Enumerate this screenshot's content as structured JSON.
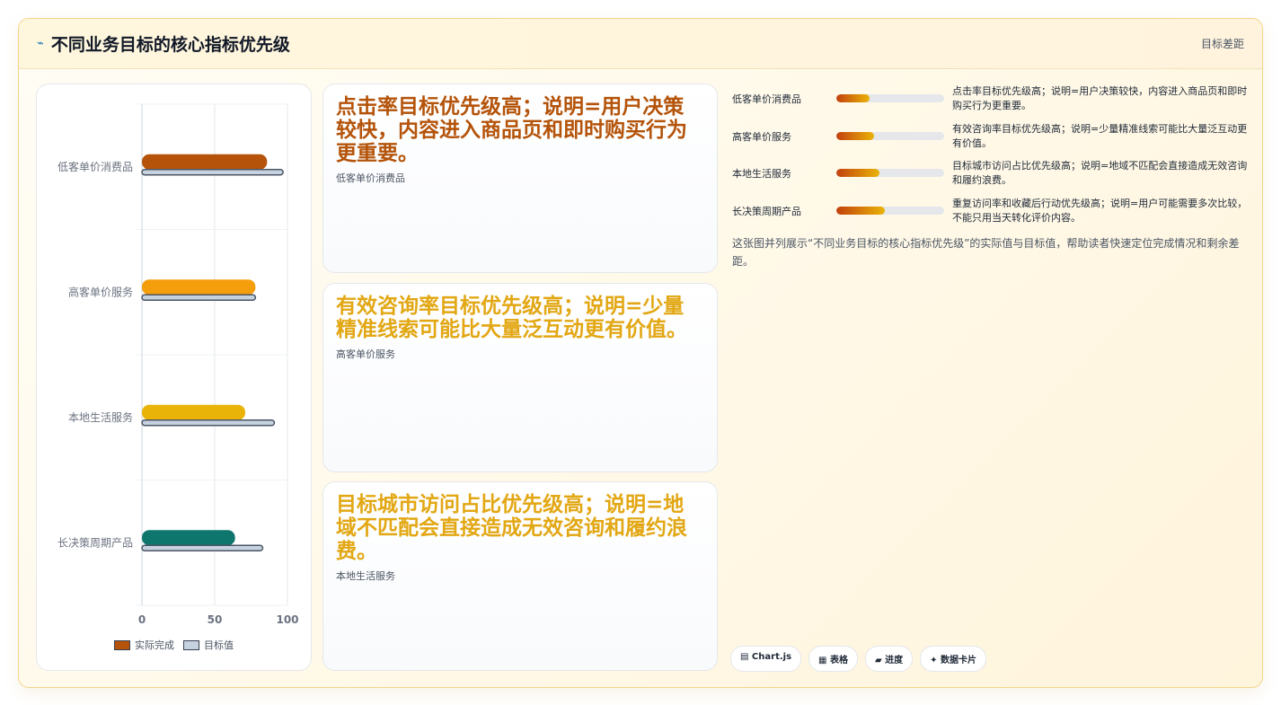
{
  "header": {
    "icon": "chart-icon",
    "title": "不同业务目标的核心指标优先级",
    "tag": "目标差距"
  },
  "legend": {
    "actual_label": "实际完成",
    "target_label": "目标值"
  },
  "chart_data": {
    "type": "bar",
    "orientation": "horizontal",
    "categories": [
      "低客单价消费品",
      "高客单价服务",
      "本地生活服务",
      "长决策周期产品"
    ],
    "series": [
      {
        "name": "实际完成",
        "values": [
          86,
          78,
          71,
          64
        ],
        "colors": [
          "#b45309",
          "#f59e0b",
          "#eab308",
          "#0f766e"
        ]
      },
      {
        "name": "目标值",
        "values": [
          97,
          78,
          91,
          83
        ],
        "color": "#c7d2e0"
      }
    ],
    "xlim": [
      0,
      100
    ],
    "xticks": [
      "0",
      "50",
      "100"
    ],
    "grid": true,
    "legend_position": "bottom"
  },
  "insights": [
    {
      "text": "点击率目标优先级高；说明=用户决策较快，内容进入商品页和即时购买行为更重要。",
      "sub": "低客单价消费品",
      "color": "#b45309"
    },
    {
      "text": "有效咨询率目标优先级高；说明=少量精准线索可能比大量泛互动更有价值。",
      "sub": "高客单价服务",
      "color": "#e2a713"
    },
    {
      "text": "目标城市访问占比优先级高；说明=地域不匹配会直接造成无效咨询和履约浪费。",
      "sub": "本地生活服务",
      "color": "#e2a713"
    }
  ],
  "progress": [
    {
      "label": "低客单价消费品",
      "value": 0.31,
      "note": "点击率目标优先级高；说明=用户决策较快，内容进入商品页和即时购买行为更重要。"
    },
    {
      "label": "高客单价服务",
      "value": 0.35,
      "note": "有效咨询率目标优先级高；说明=少量精准线索可能比大量泛互动更有价值。"
    },
    {
      "label": "本地生活服务",
      "value": 0.4,
      "note": "目标城市访问占比优先级高；说明=地域不匹配会直接造成无效咨询和履约浪费。"
    },
    {
      "label": "长决策周期产品",
      "value": 0.45,
      "note": "重复访问率和收藏后行动优先级高；说明=用户可能需要多次比较，不能只用当天转化评价内容。"
    }
  ],
  "summary": "这张图并列展示“不同业务目标的核心指标优先级”的实际值与目标值，帮助读者快速定位完成情况和剩余差距。",
  "chips": [
    "▤ Chart.js",
    "▦ 表格",
    "▰ 进度",
    "✦ 数据卡片"
  ]
}
